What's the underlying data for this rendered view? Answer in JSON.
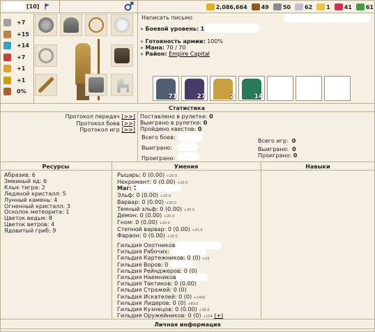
{
  "header": {
    "level": "[10]",
    "gender_icon": "male-symbol-icon"
  },
  "resources_bar": [
    {
      "icon": "gold-icon",
      "value": "2,086,664",
      "color": "#e0b020"
    },
    {
      "icon": "wood-icon",
      "value": "49",
      "color": "#8a5a2a"
    },
    {
      "icon": "ore-icon",
      "value": "50",
      "color": "#8c8c8c"
    },
    {
      "icon": "mercury-icon",
      "value": "62",
      "color": "#c0c0d0"
    },
    {
      "icon": "sulfur-icon",
      "value": "1",
      "color": "#e8c840"
    },
    {
      "icon": "crystal-icon",
      "value": "41",
      "color": "#d03050"
    },
    {
      "icon": "gems-icon",
      "value": "61",
      "color": "#40a040"
    }
  ],
  "left_stats": [
    {
      "icon": "attack-icon",
      "value": "+7",
      "color": "#a0a0a0"
    },
    {
      "icon": "defense-icon",
      "value": "+15",
      "color": "#c08040"
    },
    {
      "icon": "spell-power-icon",
      "value": "+14",
      "color": "#30a0d0"
    },
    {
      "icon": "knowledge-icon",
      "value": "+7",
      "color": "#c04040"
    },
    {
      "icon": "luck-icon",
      "value": "+1",
      "color": "#e0a030"
    },
    {
      "icon": "morale-icon",
      "value": "+1",
      "color": "#d0a000"
    },
    {
      "icon": "initiative-icon",
      "value": "0%",
      "color": "#b06030"
    }
  ],
  "character": {
    "write_letter": "Написать письмо",
    "combat_level_label": "Боевой уровень:",
    "combat_level_value": "10",
    "army_ready_label": "Готовность армии:",
    "army_ready_value": "100%",
    "mana_label": "Мана:",
    "mana_value": "70 / 70",
    "district_label": "Район:",
    "district_value": "Empire Capital"
  },
  "army": [
    {
      "icon": "steel-golem-icon",
      "count": "71",
      "color": "#506070"
    },
    {
      "icon": "archmage-icon",
      "count": "27",
      "color": "#4a3a6a"
    },
    {
      "icon": "genie-icon",
      "count": "2",
      "color": "#c8a040"
    },
    {
      "icon": "rakshasa-icon",
      "count": "14",
      "color": "#2a7a5a"
    }
  ],
  "stats": {
    "title": "Статистика",
    "links": [
      {
        "label": "Протокол передач",
        "btn": "[>>]"
      },
      {
        "label": "Протокол боев",
        "btn": "[>>]"
      },
      {
        "label": "Протокол игр",
        "btn": "[>>]"
      }
    ],
    "roulette_bet_label": "Поставлено в рулетке:",
    "roulette_bet_value": "0",
    "roulette_won_label": "Выиграно в рулетке:",
    "roulette_won_value": "0",
    "quests_label": "Пройдено квестов:",
    "quests_value": "0",
    "total_battles_label": "Всего боев:",
    "won_label": "Выиграно:",
    "lost_label": "Проиграно:",
    "total_games_label": "Всего игр:",
    "total_games_value": "0",
    "games_won_label": "Выиграно:",
    "games_won_value": "0",
    "games_lost_label": "Проиграно:",
    "games_lost_value": "0"
  },
  "resources_section": {
    "title": "Ресурсы",
    "items": [
      "Абразив: 6",
      "Змеиный яд: 6",
      "Клык тигра: 2",
      "Ледяной кристалл: 5",
      "Лунный камень: 4",
      "Огненный кристалл: 3",
      "Осколок метеорита: 1",
      "Цветок ведьм: 8",
      "Цветок ветров: 4",
      "Ядовитый гриб: 9"
    ]
  },
  "skills_section": {
    "title": "Умения",
    "factions": [
      {
        "text": "Рыцарь: 0 (0.00)",
        "suffix": "+20.0",
        "bold": false
      },
      {
        "text": "Некромант: 0 (0.00)",
        "suffix": "+20.0",
        "bold": false
      },
      {
        "text": "Маг: 7",
        "suffix": "",
        "bold": true
      },
      {
        "text": "Эльф: 0 (0.00)",
        "suffix": "+20.0",
        "bold": false
      },
      {
        "text": "Варвар: 0 (0.00)",
        "suffix": "+20.0",
        "bold": false
      },
      {
        "text": "Темный эльф: 0 (0.00)",
        "suffix": "+20.0",
        "bold": false
      },
      {
        "text": "Демон: 0 (0.00)",
        "suffix": "+20.0",
        "bold": false
      },
      {
        "text": "Гном: 0 (0.00)",
        "suffix": "+20.0",
        "bold": false
      },
      {
        "text": "Степной варвар: 0 (0.00)",
        "suffix": "+20.0",
        "bold": false
      },
      {
        "text": "Фараон: 0 (0.00)",
        "suffix": "+20.0",
        "bold": false
      }
    ],
    "guilds": [
      {
        "text": "Гильдия Охотников: 6",
        "suffix": ""
      },
      {
        "text": "Гильдия Рабочих: 7",
        "suffix": ""
      },
      {
        "text": "Гильдия Картежников: 0 (0)",
        "suffix": "+10"
      },
      {
        "text": "Гильдия Воров: 0 (3",
        "suffix": ""
      },
      {
        "text": "Гильдия Рейнджеров: 0 (0)",
        "suffix": ""
      },
      {
        "text": "Гильдия Наемников: 3",
        "suffix": ""
      },
      {
        "text": "Гильдия Тактиков: 0 (0.00)",
        "suffix": ""
      },
      {
        "text": "Гильдия Стражей: 0 (0)",
        "suffix": ""
      },
      {
        "text": "Гильдия Искателей: 0 (0)",
        "suffix": "+1400"
      },
      {
        "text": "Гильдия Лидеров: 0 (0)",
        "suffix": "+80.0"
      },
      {
        "text": "Гильдия Кузнецов: 0 (0.00)",
        "suffix": "+30.0"
      },
      {
        "text": "Гильдия Оружейников: 0 (0)",
        "suffix": "+104"
      }
    ],
    "guild_plus_link": "(+)"
  },
  "talents_section": {
    "title": "Навыки"
  },
  "personal_section": {
    "title": "Личная информация"
  }
}
